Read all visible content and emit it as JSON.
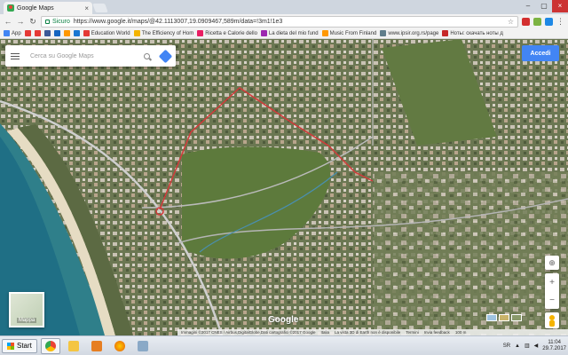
{
  "browser": {
    "tab_title": "Google Maps",
    "tab_close": "×",
    "url_secure_label": "Sicuro",
    "url": "https://www.google.it/maps/@42.1113007,19.0909467,589m/data=!3m1!1e3",
    "window_controls": [
      "–",
      "▢",
      "×"
    ]
  },
  "bookmarks": [
    {
      "label": "App",
      "color": "#4285f4"
    },
    {
      "label": "",
      "color": "#e53935"
    },
    {
      "label": "",
      "color": "#e53935"
    },
    {
      "label": "",
      "color": "#3b5998"
    },
    {
      "label": "",
      "color": "#1565c0"
    },
    {
      "label": "",
      "color": "#ff9800"
    },
    {
      "label": "",
      "color": "#1976d2"
    },
    {
      "label": "Education World",
      "color": "#e53935"
    },
    {
      "label": "The Efficiency of Hom",
      "color": "#f4b400"
    },
    {
      "label": "Ricetta e Calorie dello",
      "color": "#e91e63"
    },
    {
      "label": "La dieta del mio fund",
      "color": "#9c27b0"
    },
    {
      "label": "Music From Finland",
      "color": "#ff9800"
    },
    {
      "label": "www.ipsir.org.rs/page",
      "color": "#607d8b"
    },
    {
      "label": "Ноты: скачать ноты д",
      "color": "#c62828"
    }
  ],
  "map": {
    "search_placeholder": "Cerca su Google Maps",
    "signin_label": "Accedi",
    "minimap_label": "Mappa",
    "logo": "Google",
    "zoom_in": "+",
    "zoom_out": "−",
    "compass": "⊕",
    "attribution": [
      "Immagini ©2017 CNES / Airbus,DigitalGlobe,Dati cartografici ©2017 Google",
      "Italia",
      "La vista 3D di Earth non è disponibile",
      "Termini",
      "Invia feedback",
      "100 m"
    ]
  },
  "taskbar": {
    "start_label": "Start",
    "language": "SR",
    "time": "11:04",
    "date": "29.7.2017"
  },
  "colors": {
    "accent": "#4285f4",
    "route": "#d23a3a",
    "water": "#4a8fb0"
  }
}
